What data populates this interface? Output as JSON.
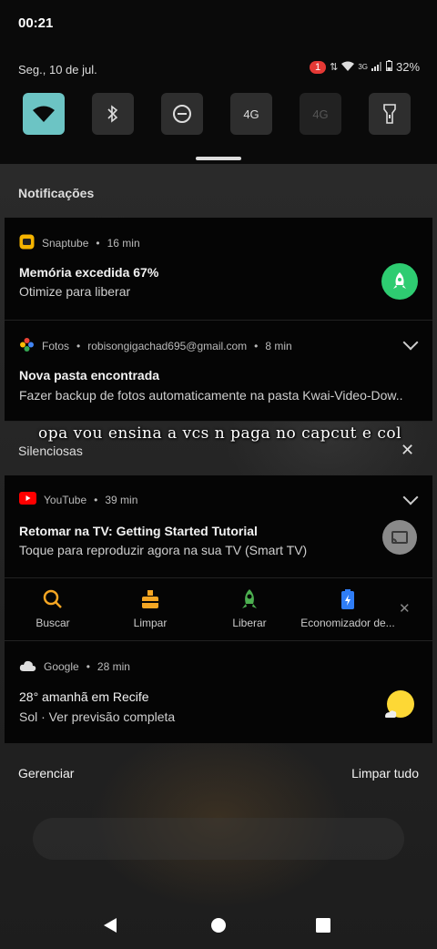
{
  "status_bar": {
    "time": "00:21",
    "date": "Seg., 10 de jul.",
    "notification_count": "1",
    "network_label": "3G",
    "battery": "32%"
  },
  "quick_settings": {
    "tiles": [
      {
        "name": "wifi",
        "label": "",
        "state": "on"
      },
      {
        "name": "bluetooth",
        "label": "",
        "state": "off"
      },
      {
        "name": "do-not-disturb",
        "label": "",
        "state": "off"
      },
      {
        "name": "mobile-data-4g",
        "label": "4G",
        "state": "off"
      },
      {
        "name": "4g-disabled",
        "label": "4G",
        "state": "disabled"
      },
      {
        "name": "flashlight",
        "label": "",
        "state": "off"
      }
    ]
  },
  "notifications_header": "Notificações",
  "notifications": [
    {
      "app": "Snaptube",
      "time": "16 min",
      "title": "Memória excedida 67%",
      "body": "Otimize para liberar"
    },
    {
      "app": "Fotos",
      "account": "robisongigachad695@gmail.com",
      "time": "8 min",
      "title": "Nova pasta encontrada",
      "body": "Fazer backup de fotos automaticamente na pasta Kwai-Video-Dow.."
    }
  ],
  "overlay_caption": "opa vou ensina a vcs n paga no capcut e col",
  "silent_header": "Silenciosas",
  "silent_notifications": {
    "youtube": {
      "app": "YouTube",
      "time": "39 min",
      "title": "Retomar na TV: Getting Started Tutorial",
      "body": "Toque para reproduzir agora na sua TV (Smart TV)"
    },
    "actions": [
      {
        "label": "Buscar",
        "icon": "search-icon",
        "color": "#f5a623"
      },
      {
        "label": "Limpar",
        "icon": "broom-icon",
        "color": "#f5a623"
      },
      {
        "label": "Liberar",
        "icon": "rocket-icon",
        "color": "#4caf50"
      },
      {
        "label": "Economizador de...",
        "icon": "battery-saver-icon",
        "color": "#2f7df6"
      }
    ],
    "google": {
      "app": "Google",
      "time": "28 min",
      "title": "28° amanhã em Recife",
      "body": "Sol · Ver previsão completa"
    }
  },
  "footer": {
    "manage": "Gerenciar",
    "clear_all": "Limpar tudo"
  },
  "navigation": {
    "back": "back-icon",
    "home": "home-icon",
    "recents": "recents-icon"
  },
  "colors": {
    "accent_teal": "#6cc4c4",
    "snaptube_green": "#2ecc71",
    "youtube_red": "#ff0000"
  }
}
